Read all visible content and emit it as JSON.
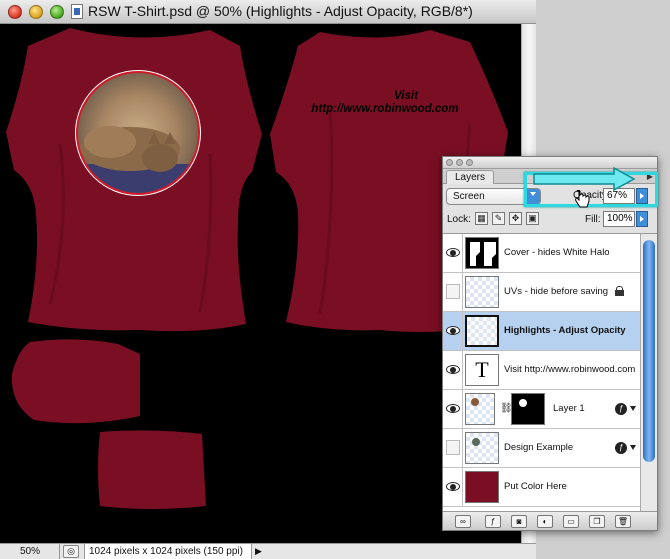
{
  "window": {
    "title": "RSW T-Shirt.psd @ 50% (Highlights - Adjust Opacity, RGB/8*)"
  },
  "canvas": {
    "shirt_color": "#7a0f24",
    "shirt_text_line1": "Visit",
    "shirt_text_line2": "http://www.robinwood.com"
  },
  "status_bar": {
    "zoom": "50%",
    "doc_info": "1024 pixels x 1024 pixels (150 ppi)"
  },
  "layers_panel": {
    "tab": "Layers",
    "blend_mode": "Screen",
    "opacity_label": "Opacity:",
    "opacity_value": "67%",
    "lock_label": "Lock:",
    "fill_label": "Fill:",
    "fill_value": "100%",
    "selection_color": "#b5d1ef",
    "annotation_color": "#2ed8e0",
    "layers": [
      {
        "name": "Cover - hides White Halo",
        "visible": true
      },
      {
        "name": "UVs - hide before saving",
        "visible": false,
        "locked": true
      },
      {
        "name": "Highlights - Adjust Opacity",
        "visible": true,
        "selected": true
      },
      {
        "name": "Visit http://www.robinwood.com",
        "visible": true,
        "type": "text",
        "thumb_text": "T"
      },
      {
        "name": "Layer 1",
        "visible": true,
        "has_mask": true,
        "has_fx": true
      },
      {
        "name": "Design Example",
        "visible": false,
        "has_fx": true
      },
      {
        "name": "Put Color Here",
        "visible": true
      }
    ]
  }
}
